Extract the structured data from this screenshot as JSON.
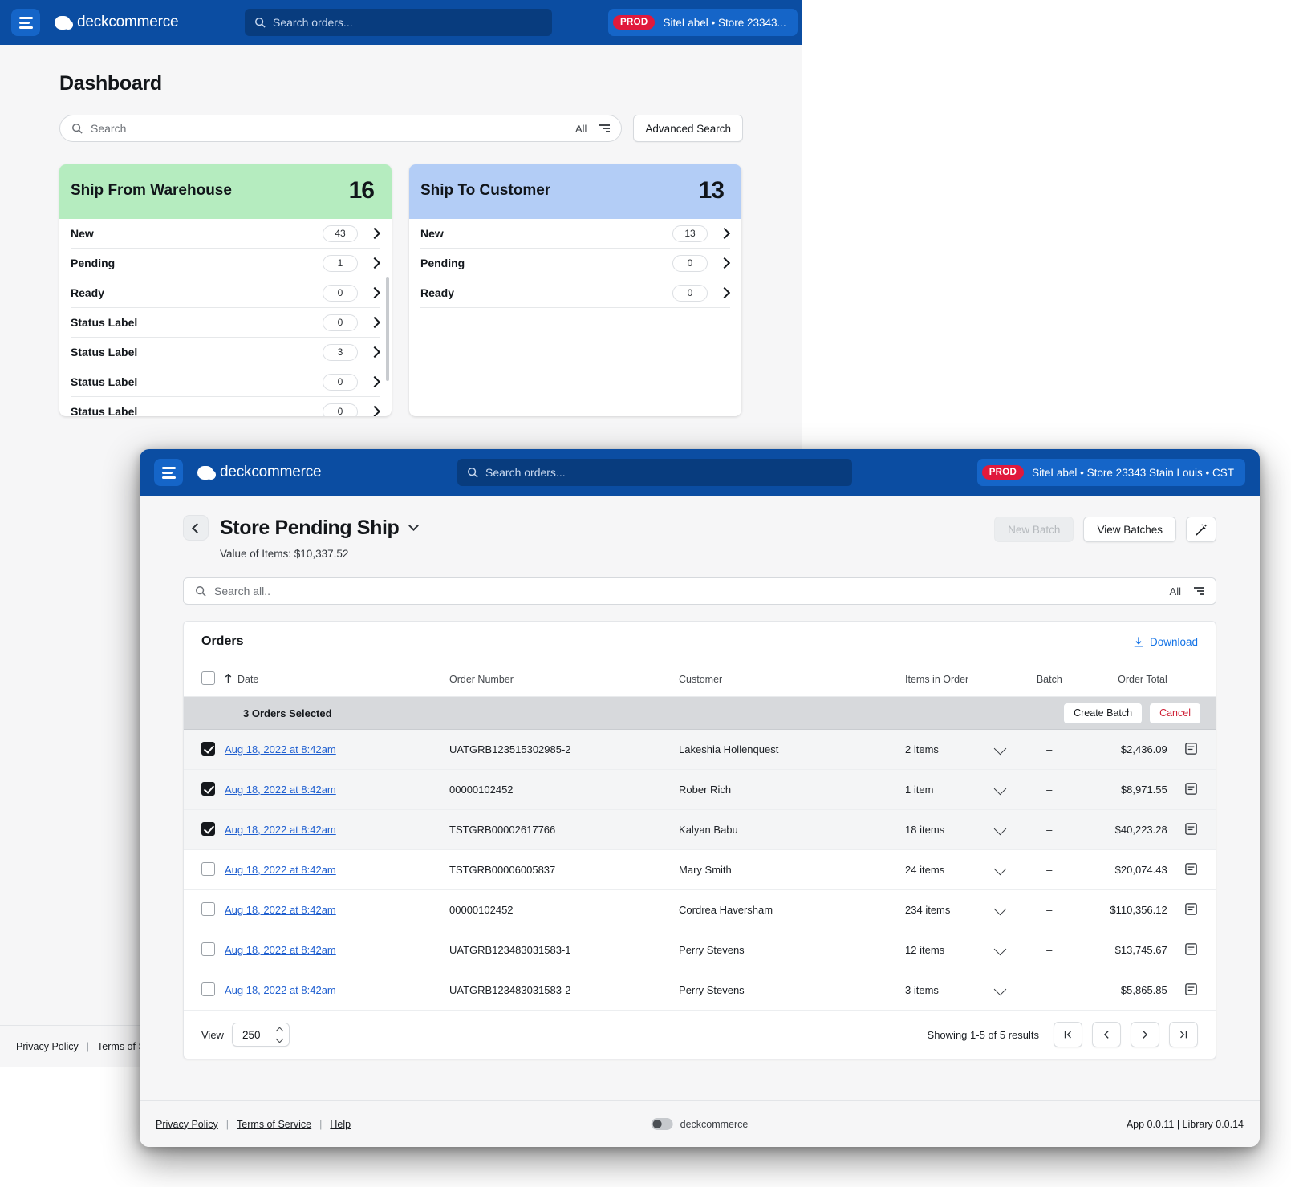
{
  "brand": {
    "name": "deckcommerce"
  },
  "back_window": {
    "topbar": {
      "search_placeholder": "Search orders...",
      "store_badge_tag": "PROD",
      "store_badge_text": "SiteLabel • Store 23343..."
    },
    "page_title": "Dashboard",
    "search": {
      "placeholder": "Search",
      "filter_label": "All",
      "advanced_button": "Advanced Search"
    },
    "cards": [
      {
        "title": "Ship From Warehouse",
        "count": "16",
        "accent": "#b5ecbf",
        "rows": [
          {
            "label": "New",
            "count": "43"
          },
          {
            "label": "Pending",
            "count": "1"
          },
          {
            "label": "Ready",
            "count": "0"
          },
          {
            "label": "Status Label",
            "count": "0"
          },
          {
            "label": "Status Label",
            "count": "3"
          },
          {
            "label": "Status Label",
            "count": "0"
          },
          {
            "label": "Status Label",
            "count": "0"
          }
        ]
      },
      {
        "title": "Ship To Customer",
        "count": "13",
        "accent": "#b3cdf6",
        "rows": [
          {
            "label": "New",
            "count": "13"
          },
          {
            "label": "Pending",
            "count": "0"
          },
          {
            "label": "Ready",
            "count": "0"
          }
        ]
      }
    ],
    "footer": {
      "privacy": "Privacy Policy",
      "terms": "Terms of Se"
    }
  },
  "front_window": {
    "topbar": {
      "search_placeholder": "Search orders...",
      "store_badge_tag": "PROD",
      "store_badge_text": "SiteLabel • Store 23343 Stain Louis • CST"
    },
    "page_title": "Store Pending Ship",
    "value_of_items": "Value of Items: $10,337.52",
    "actions": {
      "new_batch": "New Batch",
      "view_batches": "View Batches"
    },
    "search": {
      "placeholder": "Search all..",
      "filter_label": "All"
    },
    "orders": {
      "title": "Orders",
      "download_label": "Download",
      "columns": {
        "date": "Date",
        "order_number": "Order Number",
        "customer": "Customer",
        "items_in_order": "Items in Order",
        "batch": "Batch",
        "order_total": "Order Total"
      },
      "selection_bar": {
        "text": "3 Orders Selected",
        "create_batch": "Create Batch",
        "cancel": "Cancel"
      },
      "rows": [
        {
          "selected": true,
          "date": "Aug 18, 2022 at 8:42am",
          "order_number": "UATGRB123515302985-2",
          "customer": "Lakeshia Hollenquest",
          "items": "2 items",
          "batch": "–",
          "total": "$2,436.09"
        },
        {
          "selected": true,
          "date": "Aug 18, 2022 at 8:42am",
          "order_number": "00000102452",
          "customer": "Rober Rich",
          "items": "1 item",
          "batch": "–",
          "total": "$8,971.55"
        },
        {
          "selected": true,
          "date": "Aug 18, 2022 at 8:42am",
          "order_number": "TSTGRB00002617766",
          "customer": "Kalyan Babu",
          "items": "18 items",
          "batch": "–",
          "total": "$40,223.28"
        },
        {
          "selected": false,
          "date": "Aug 18, 2022 at 8:42am",
          "order_number": "TSTGRB00006005837",
          "customer": "Mary Smith",
          "items": "24 items",
          "batch": "–",
          "total": "$20,074.43"
        },
        {
          "selected": false,
          "date": "Aug 18, 2022 at 8:42am",
          "order_number": "00000102452",
          "customer": "Cordrea Haversham",
          "items": "234 items",
          "batch": "–",
          "total": "$110,356.12"
        },
        {
          "selected": false,
          "date": "Aug 18, 2022 at 8:42am",
          "order_number": "UATGRB123483031583-1",
          "customer": "Perry Stevens",
          "items": "12 items",
          "batch": "–",
          "total": "$13,745.67"
        },
        {
          "selected": false,
          "date": "Aug 18, 2022 at 8:42am",
          "order_number": "UATGRB123483031583-2",
          "customer": "Perry Stevens",
          "items": "3 items",
          "batch": "–",
          "total": "$5,865.85"
        }
      ],
      "footer": {
        "view_label": "View",
        "page_size": "250",
        "results_text": "Showing 1-5 of 5 results"
      }
    },
    "footer": {
      "privacy": "Privacy Policy",
      "terms": "Terms of Service",
      "help": "Help",
      "brand": "deckcommerce",
      "version": "App 0.0.11 | Library 0.0.14"
    }
  }
}
